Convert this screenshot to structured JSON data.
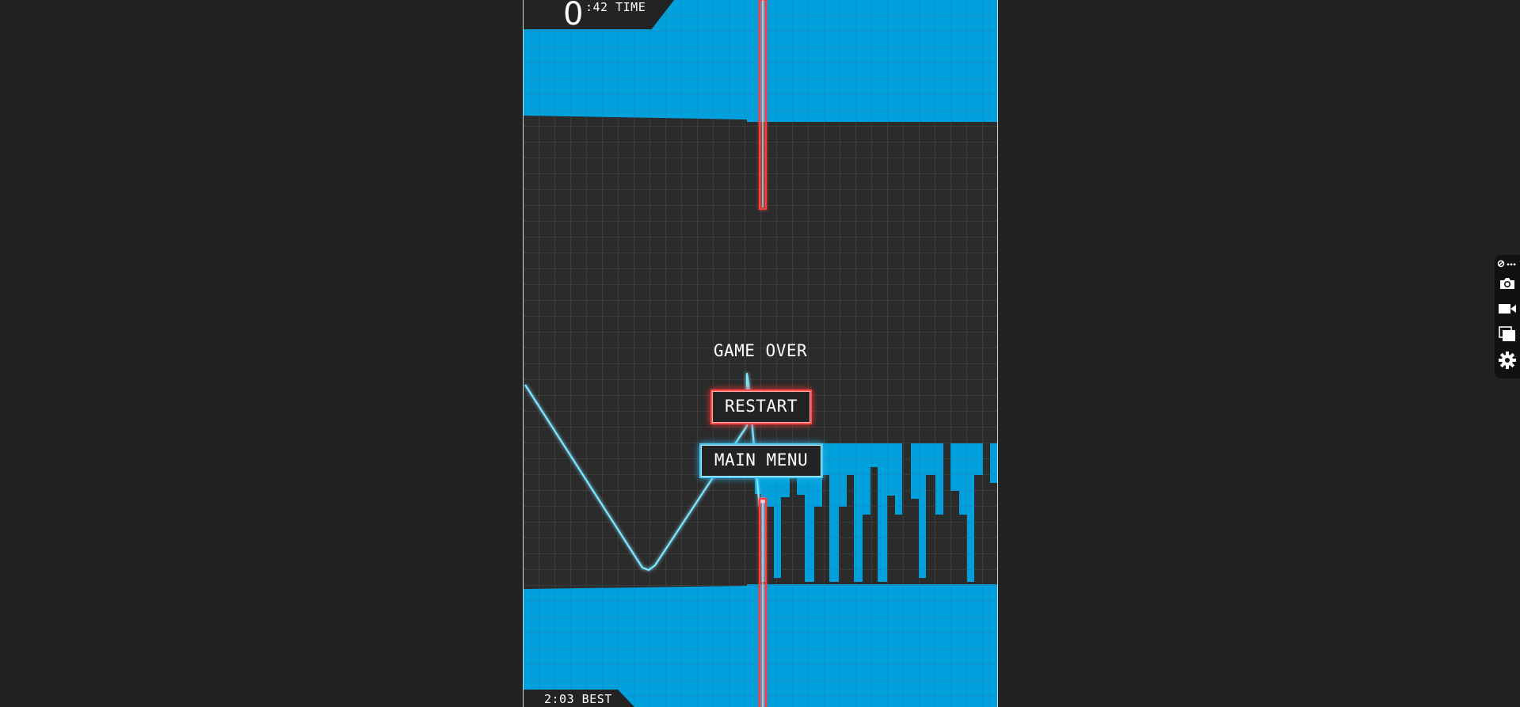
{
  "hud": {
    "time_big": "0",
    "time_small": ":42 TIME",
    "best": "2:03 BEST"
  },
  "overlay": {
    "title": "GAME OVER",
    "restart_label": "RESTART",
    "menu_label": "MAIN MENU"
  },
  "colors": {
    "background": "#222222",
    "wall_blue": "#00a0dc",
    "tunnel_dark": "#2b2b2b",
    "laser_red": "#ff3b3b",
    "trail_cyan": "#7fe6ff"
  },
  "toolbar": {
    "icons": [
      "link-more-icon",
      "camera-icon",
      "video-camera-icon",
      "windows-icon",
      "gear-icon"
    ]
  }
}
